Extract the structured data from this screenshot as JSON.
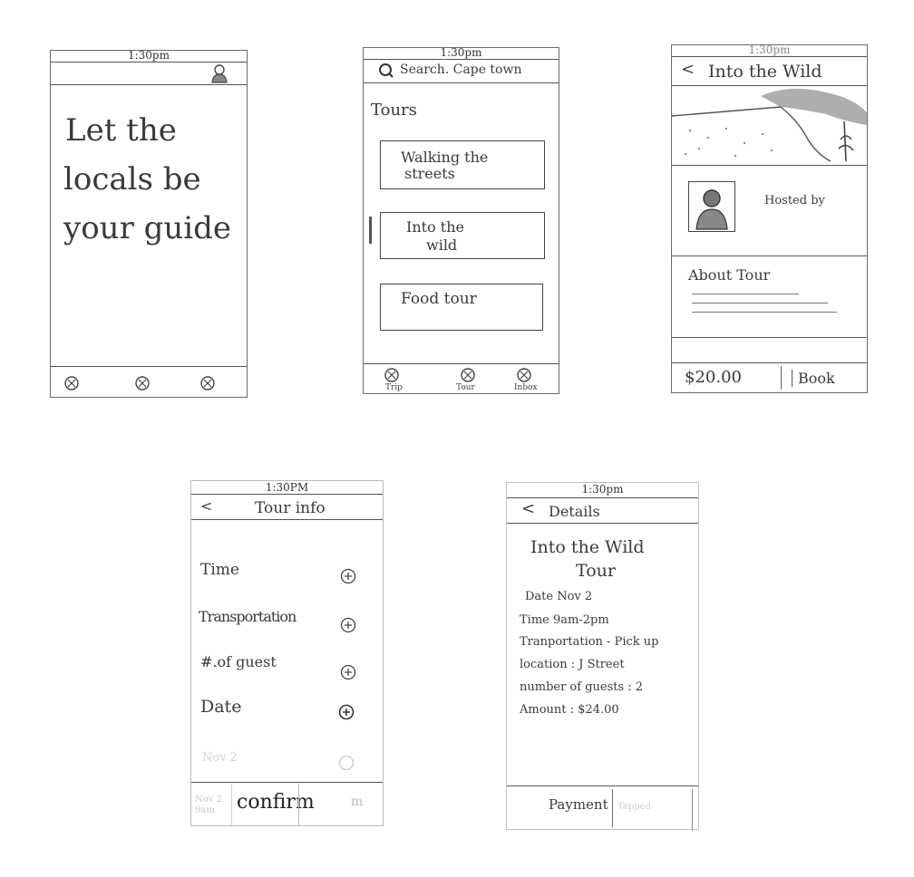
{
  "screen1": {
    "time": "1:30pm",
    "headline": [
      "Let the",
      "locals be",
      "your guide"
    ],
    "tabs": [
      "",
      "",
      ""
    ]
  },
  "screen2": {
    "time": "1:30pm",
    "search_text": "Search. Cape town",
    "section_title": "Tours",
    "tours": [
      {
        "line1": "Walking the",
        "line2": "streets"
      },
      {
        "line1": "Into the",
        "line2": "wild"
      },
      {
        "line1": "Food tour",
        "line2": ""
      }
    ],
    "tabs": [
      "Trip",
      "Tour",
      "Inbox"
    ]
  },
  "screen3": {
    "time": "1:30pm",
    "title": "Into the Wild",
    "hosted_by": "Hosted by",
    "about": "About Tour",
    "price": "$20.00",
    "book": "Book"
  },
  "screen4": {
    "time": "1:30PM",
    "title": "Tour info",
    "options": [
      "Time",
      "Transportation",
      "#.of guest",
      "Date"
    ],
    "faded_option": "Nov 2",
    "confirm": "confirm",
    "faded_footer_left": "Nov 2 9am",
    "faded_footer_right": "m"
  },
  "screen5": {
    "time": "1:30pm",
    "title": "Details",
    "heading_line1": "Into the Wild",
    "heading_line2": "Tour",
    "details": [
      "Date  Nov 2",
      "Time  9am-2pm",
      "Tranportation - Pick up",
      "location : J Street",
      "number of guests : 2",
      "Amount : $24.00"
    ],
    "payment": "Payment",
    "faded_right": "Tapped"
  }
}
